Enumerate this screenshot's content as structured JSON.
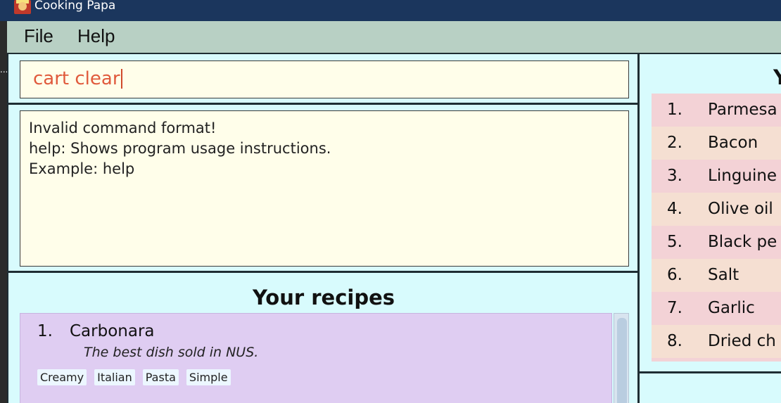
{
  "window": {
    "title": "Cooking Papa",
    "left_marker": "..."
  },
  "menu": {
    "file": "File",
    "help": "Help"
  },
  "command": {
    "value": "cart clear"
  },
  "result": {
    "lines": [
      "Invalid command format!",
      "help: Shows program usage instructions.",
      "Example: help"
    ]
  },
  "recipes": {
    "title": "Your recipes",
    "items": [
      {
        "index": "1.",
        "name": "Carbonara",
        "description": "The best dish sold in NUS.",
        "tags": [
          "Creamy",
          "Italian",
          "Pasta",
          "Simple"
        ]
      }
    ]
  },
  "cart": {
    "heading_partial": "Y",
    "items": [
      {
        "index": "1.",
        "name": "Parmesa"
      },
      {
        "index": "2.",
        "name": "Bacon"
      },
      {
        "index": "3.",
        "name": "Linguine"
      },
      {
        "index": "4.",
        "name": "Olive oil"
      },
      {
        "index": "5.",
        "name": "Black pe"
      },
      {
        "index": "6.",
        "name": "Salt"
      },
      {
        "index": "7.",
        "name": "Garlic"
      },
      {
        "index": "8.",
        "name": "Dried ch"
      }
    ]
  },
  "colors": {
    "titlebar": "#1b365d",
    "menubar": "#b8d0c4",
    "panel": "#d8fbfd",
    "input_bg": "#fffeea",
    "command_text": "#e05a3c",
    "recipe_card": "#dfcdf2",
    "cart_row_odd": "#f3d2d6",
    "cart_row_even": "#f5dfd2"
  }
}
